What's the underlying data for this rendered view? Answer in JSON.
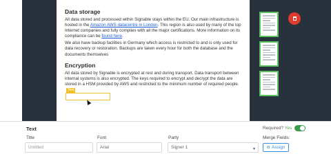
{
  "document": {
    "heading1": "Data storage",
    "p1_a": "All data stored and processed within Signable stays within the EU. Our main infrastructure is hosted in the ",
    "p1_link": "Amazon AWS datacentre in London",
    "p1_b": ". This region is also used by many of the top Internet companies and fully complies with all the major certifications. More information on its compliance can be ",
    "p1_link2": "found here",
    "p1_c": ".",
    "p2": "We also have backup facilities in Germany which access is restricted to and is only used for data recovery or restoration. Backups are taken every hour for both the database and the documents themselves",
    "heading2": "Encryption",
    "p3": "All data stored by Signable is encrypted at rest and during transport. Data transport between internal systems is also encrypted. The keys required to encrypt and decrypt the data are stored in a HSM provided by AWS and restricted to the minimum number of required people."
  },
  "panel": {
    "title": "Text",
    "required_label": "Required?",
    "required_value": "Yes",
    "required_on": true,
    "title_label": "Title",
    "title_placeholder": "Untitled",
    "font_label": "Font",
    "font_value": "Arial",
    "party_label": "Party",
    "party_value": "Signer 1",
    "merge_label": "Merge Fields:",
    "assign_label": "Assign"
  },
  "colors": {
    "accent": "#59c15e",
    "delete": "#e03b2f",
    "field_highlight": "#f0c22b",
    "link": "#3b8fd9"
  },
  "icons": {
    "delete": "trash-icon",
    "assign": "gear-icon",
    "dropdown": "chevron-down-icon"
  }
}
